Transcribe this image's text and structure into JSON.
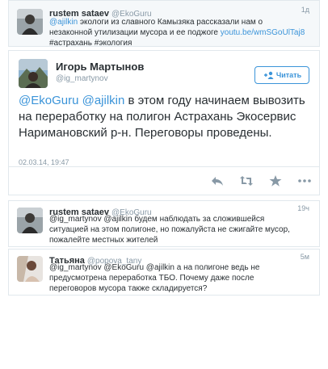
{
  "parent_tweet": {
    "author_name": "rustem sataev",
    "author_handle": "@EkoGuru",
    "time": "1д",
    "text_mention": "@ajilkin",
    "text_body": " экологи из славного Камызяка рассказали нам о незаконной утилизации мусора и ее поджоге ",
    "text_link": "youtu.be/wmSGoUlTaj8",
    "text_hashtags": "#астрахань #экология"
  },
  "main_tweet": {
    "author_name": "Игорь Мартынов",
    "author_handle": "@ig_martynov",
    "follow_label": "Читать",
    "mention1": "@EkoGuru",
    "mention2": "@ajilkin",
    "text": " в этом году начинаем вывозить на переработку на полигон Астрахань Экосервис Наримановский р-н. Переговоры проведены.",
    "date": "02.03.14, 19:47"
  },
  "replies": [
    {
      "author_name": "rustem sataev",
      "author_handle": "@EkoGuru",
      "time": "19ч",
      "text": "@ig_martynov @ajilkin будем наблюдать за сложившейся ситуацией на этом полигоне, но пожалуйста не сжигайте мусор, пожалейте местных жителей"
    },
    {
      "author_name": "Татьяна",
      "author_handle": "@popova_tany",
      "time": "5м",
      "text": "@ig_martynov @EkoGuru @ajilkin а на полигоне ведь не предусмотрена переработка ТБО. Почему даже после переговоров мусора также складируется?"
    }
  ],
  "icons": {
    "reply": "reply-icon",
    "retweet": "retweet-icon",
    "favorite": "star-icon",
    "more": "more-icon",
    "follow": "follow-user-icon"
  },
  "colors": {
    "link": "#3b94d9",
    "muted": "#8899a6",
    "text": "#292f33",
    "border": "#e1e8ed"
  }
}
